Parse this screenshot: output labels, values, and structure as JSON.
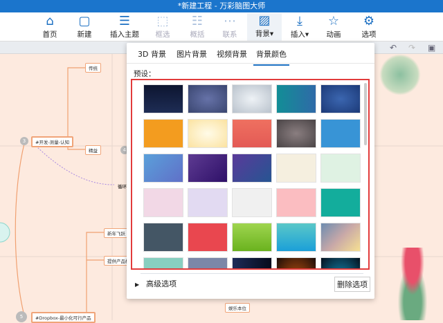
{
  "window": {
    "title": "*新建工程 - 万彩脑图大师"
  },
  "toolbar": {
    "items": [
      {
        "label": "首页",
        "icon": "home-icon",
        "enabled": true
      },
      {
        "label": "新建",
        "icon": "new-file-icon",
        "enabled": true
      },
      {
        "label": "插入主题",
        "icon": "insert-topic-icon",
        "enabled": true
      },
      {
        "label": "框选",
        "icon": "box-select-icon",
        "enabled": false
      },
      {
        "label": "概括",
        "icon": "summary-icon",
        "enabled": false
      },
      {
        "label": "联系",
        "icon": "relation-icon",
        "enabled": false
      },
      {
        "label": "背景▾",
        "icon": "background-icon",
        "enabled": true
      },
      {
        "label": "插入▾",
        "icon": "insert-icon",
        "enabled": true
      },
      {
        "label": "动画",
        "icon": "animation-icon",
        "enabled": true
      },
      {
        "label": "选项",
        "icon": "settings-icon",
        "enabled": true
      }
    ]
  },
  "canvas": {
    "nodes": [
      "传统",
      "#开发-测量-认知",
      "精益",
      "新年飞跃",
      "提供产品核",
      "#Dropbox-最小化可行产品",
      "娱乐本位",
      "循环"
    ],
    "badges": [
      "3",
      "4",
      "5"
    ]
  },
  "panel": {
    "tabs": [
      "3D 背景",
      "图片背景",
      "视频背景",
      "背景颜色"
    ],
    "selected_tab": "背景颜色",
    "preset_label": "预设：",
    "swatches": [
      "linear-gradient(#0d1530,#1e2d55)",
      "radial-gradient(#6672a8,#3a4670)",
      "radial-gradient(#eef2f6,#b9c2cc)",
      "linear-gradient(90deg,#128e96,#2f6aa8)",
      "radial-gradient(#3b66b0,#1c3a78)",
      "#f39c1f",
      "radial-gradient(#fffbe8,#fbe2a0)",
      "linear-gradient(#ef7060,#e35a55)",
      "radial-gradient(#8a7e80,#4a4446)",
      "#3894d6",
      "linear-gradient(135deg,#5aa0da,#6070c8)",
      "linear-gradient(135deg,#5e3b92,#2e1068)",
      "linear-gradient(135deg,#5a3a9a,#265592)",
      "#f5efdf",
      "#dff2e3",
      "#f2d8e6",
      "#e2daf2",
      "#f0f0f0",
      "#fbbdc1",
      "#13ad9c",
      "#445665",
      "#e9474f",
      "linear-gradient(#9fd54f,#6ab21e)",
      "linear-gradient(#5ac8c8,#1b9fd8)",
      "linear-gradient(135deg,#6d8cb0,#c8a8a8,#f6e092)",
      "#88cfc0",
      "#7c87a8",
      "linear-gradient(90deg,#1c2b58,#050b1c)",
      "radial-gradient(ellipse at bottom,#d05a10,#1a0c08)",
      "radial-gradient(ellipse at bottom,#1a9ac8,#04101c)"
    ],
    "advanced_label": "高级选项",
    "delete_button": "删除选项"
  }
}
